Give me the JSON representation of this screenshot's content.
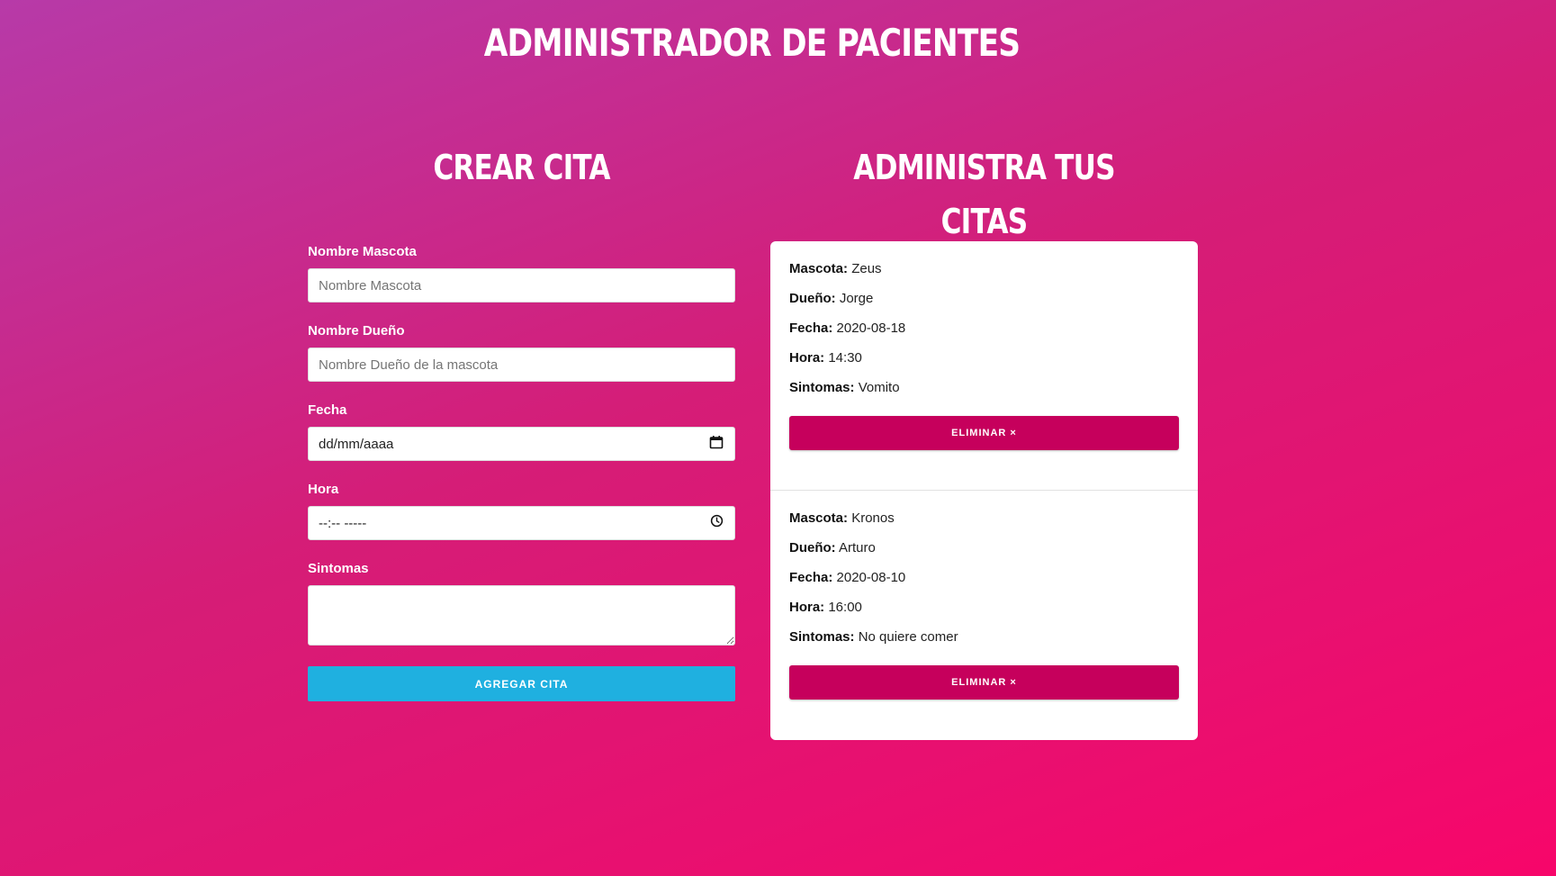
{
  "header": {
    "title": "Administrador de Pacientes"
  },
  "form": {
    "title": "Crear Cita",
    "fields": {
      "mascota": {
        "label": "Nombre Mascota",
        "placeholder": "Nombre Mascota",
        "value": ""
      },
      "propietario": {
        "label": "Nombre Dueño",
        "placeholder": "Nombre Dueño de la mascota",
        "value": ""
      },
      "fecha": {
        "label": "Fecha",
        "display": "dd/mm/aaaa",
        "icon": "calendar-icon"
      },
      "hora": {
        "label": "Hora",
        "display": "--:-- -----",
        "icon": "clock-icon"
      },
      "sintomas": {
        "label": "Sintomas",
        "value": ""
      }
    },
    "submit_label": "Agregar Cita"
  },
  "list": {
    "title": "Administra tus citas",
    "labels": {
      "mascota": "Mascota:",
      "propietario": "Dueño:",
      "fecha": "Fecha:",
      "hora": "Hora:",
      "sintomas": "Sintomas:"
    },
    "delete_label": "Eliminar ×",
    "citas": [
      {
        "mascota": "Zeus",
        "propietario": "Jorge",
        "fecha": "2020-08-18",
        "hora": "14:30",
        "sintomas": "Vomito"
      },
      {
        "mascota": "Kronos",
        "propietario": "Arturo",
        "fecha": "2020-08-10",
        "hora": "16:00",
        "sintomas": "No quiere comer"
      }
    ]
  },
  "colors": {
    "background_start": "#b73aa8",
    "background_end": "#f7066a",
    "add_button": "#1fb0e0",
    "delete_button": "#c6005c",
    "card": "#ffffff"
  }
}
